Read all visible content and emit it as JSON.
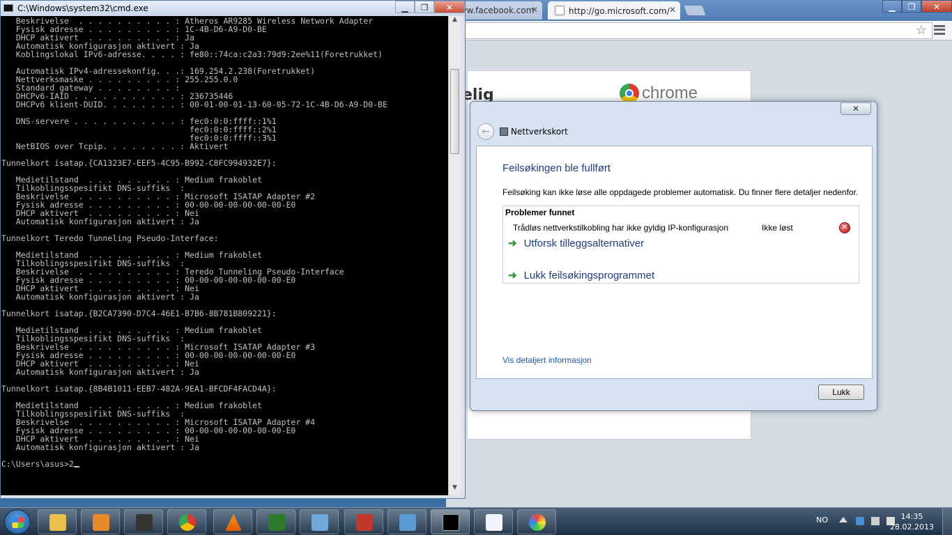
{
  "cmd": {
    "title": "C:\\Windows\\system32\\cmd.exe",
    "lines": [
      "   Beskrivelse  . . . . . . . . . . : Atheros AR9285 Wireless Network Adapter",
      "   Fysisk adresse . . . . . . . . . : 1C-4B-D6-A9-D0-BE",
      "   DHCP aktivert  . . . . . . . . . : Ja",
      "   Automatisk konfigurasjon aktivert : Ja",
      "   Koblingslokal IPv6-adresse. . . . : fe80::74ca:c2a3:79d9:2ee%11(Foretrukket)",
      "",
      "   Automatisk IPv4-adressekonfig. . .: 169.254.2.238(Foretrukket)",
      "   Nettverksmaske . . . . . . . . . : 255.255.0.0",
      "   Standard gateway . . . . . . . . :",
      "   DHCPv6-IAID . . . . . . . . . . . : 236735446",
      "   DHCPv6 klient-DUID. . . . . . . . : 00-01-00-01-13-60-05-72-1C-4B-D6-A9-D0-BE",
      "",
      "   DNS-servere . . . . . . . . . . . : fec0:0:0:ffff::1%1",
      "                                       fec0:0:0:ffff::2%1",
      "                                       fec0:0:0:ffff::3%1",
      "   NetBIOS over Tcpip. . . . . . . . : Aktivert",
      "",
      "Tunnelkort isatap.{CA1323E7-EEF5-4C95-B992-C8FC994932E7}:",
      "",
      "   Medietilstand  . . . . . . . . . : Medium frakoblet",
      "   Tilkoblingsspesifikt DNS-suffiks  :",
      "   Beskrivelse  . . . . . . . . . . : Microsoft ISATAP Adapter #2",
      "   Fysisk adresse . . . . . . . . . : 00-00-00-00-00-00-00-E0",
      "   DHCP aktivert  . . . . . . . . . : Nei",
      "   Automatisk konfigurasjon aktivert : Ja",
      "",
      "Tunnelkort Teredo Tunneling Pseudo-Interface:",
      "",
      "   Medietilstand  . . . . . . . . . : Medium frakoblet",
      "   Tilkoblingsspesifikt DNS-suffiks  :",
      "   Beskrivelse  . . . . . . . . . . : Teredo Tunneling Pseudo-Interface",
      "   Fysisk adresse . . . . . . . . . : 00-00-00-00-00-00-00-E0",
      "   DHCP aktivert  . . . . . . . . . : Nei",
      "   Automatisk konfigurasjon aktivert : Ja",
      "",
      "Tunnelkort isatap.{B2CA7390-D7C4-46E1-B7B6-8B781B809221}:",
      "",
      "   Medietilstand  . . . . . . . . . : Medium frakoblet",
      "   Tilkoblingsspesifikt DNS-suffiks  :",
      "   Beskrivelse  . . . . . . . . . . : Microsoft ISATAP Adapter #3",
      "   Fysisk adresse . . . . . . . . . : 00-00-00-00-00-00-00-E0",
      "   DHCP aktivert  . . . . . . . . . : Nei",
      "   Automatisk konfigurasjon aktivert : Ja",
      "",
      "Tunnelkort isatap.{8B4B1011-EEB7-482A-9EA1-BFCDF4FACD4A}:",
      "",
      "   Medietilstand  . . . . . . . . . : Medium frakoblet",
      "   Tilkoblingsspesifikt DNS-suffiks  :",
      "   Beskrivelse  . . . . . . . . . . : Microsoft ISATAP Adapter #4",
      "   Fysisk adresse . . . . . . . . . : 00-00-00-00-00-00-00-E0",
      "   DHCP aktivert  . . . . . . . . . : Nei",
      "   Automatisk konfigurasjon aktivert : Ja",
      "",
      "C:\\Users\\asus>2"
    ]
  },
  "chrome": {
    "tabs": [
      {
        "label": "www.facebook.com",
        "active": false
      },
      {
        "label": "http://go.microsoft.com/",
        "active": true
      }
    ],
    "page_heading": "elig",
    "logo_text": "chrome"
  },
  "dialog": {
    "breadcrumb": "Nettverkskort",
    "title": "Feilsøkingen ble fullført",
    "description": "Feilsøking kan ikke løse alle oppdagede problemer automatisk. Du finner flere detaljer nedenfor.",
    "problems_header": "Problemer funnet",
    "problems": [
      {
        "text": "Trådløs nettverkstilkobling har ikke gyldig IP-konfigurasjon",
        "status": "Ikke løst"
      }
    ],
    "options": [
      "Utforsk tilleggsalternativer",
      "Lukk feilsøkingsprogrammet"
    ],
    "details_link": "Vis detaljert informasjon",
    "close_button": "Lukk"
  },
  "taskbar": {
    "apps": [
      "windows-explorer",
      "media-player",
      "webcam",
      "chrome",
      "vlc",
      "network-tool",
      "control-panel",
      "toolbox",
      "network-adapter",
      "cmd",
      "document",
      "paint"
    ],
    "language": "NO",
    "time": "14:35",
    "date": "28.02.2013"
  }
}
